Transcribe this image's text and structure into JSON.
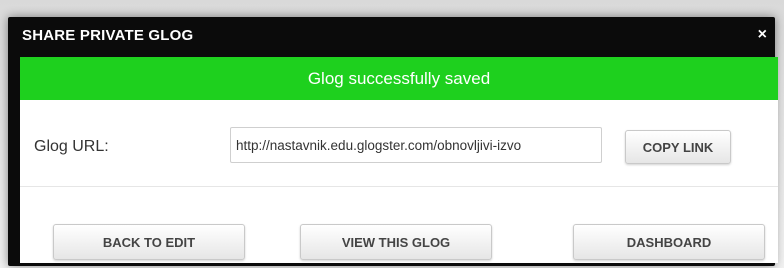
{
  "dialog": {
    "title": "SHARE PRIVATE GLOG",
    "close_symbol": "×",
    "banner_text": "Glog successfully saved",
    "banner_color": "#1ed01e"
  },
  "url_row": {
    "label": "Glog URL:",
    "value": "http://nastavnik.edu.glogster.com/obnovljivi-izvo",
    "copy_label": "COPY LINK"
  },
  "actions": {
    "back_label": "BACK TO EDIT",
    "view_label": "VIEW THIS GLOG",
    "dashboard_label": "DASHBOARD"
  }
}
